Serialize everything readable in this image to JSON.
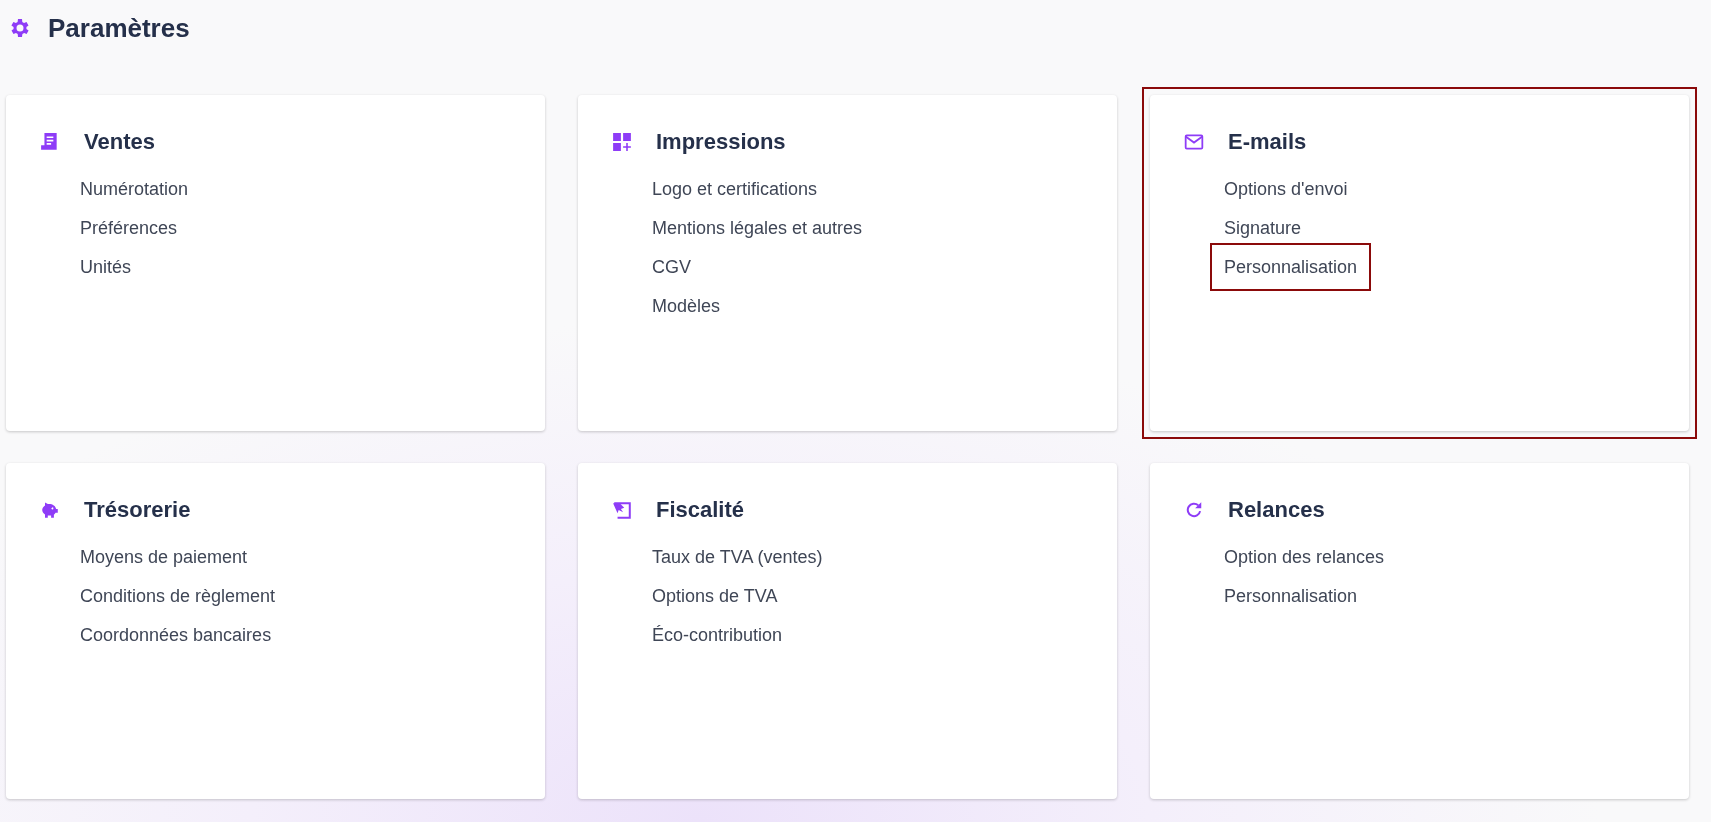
{
  "page": {
    "title": "Paramètres"
  },
  "cards": [
    {
      "title": "Ventes",
      "highlighted": false,
      "items": [
        {
          "label": "Numérotation",
          "highlighted": false
        },
        {
          "label": "Préférences",
          "highlighted": false
        },
        {
          "label": "Unités",
          "highlighted": false
        }
      ]
    },
    {
      "title": "Impressions",
      "highlighted": false,
      "items": [
        {
          "label": "Logo et certifications",
          "highlighted": false
        },
        {
          "label": "Mentions légales et autres",
          "highlighted": false
        },
        {
          "label": "CGV",
          "highlighted": false
        },
        {
          "label": "Modèles",
          "highlighted": false
        }
      ]
    },
    {
      "title": "E-mails",
      "highlighted": true,
      "items": [
        {
          "label": "Options d'envoi",
          "highlighted": false
        },
        {
          "label": "Signature",
          "highlighted": false
        },
        {
          "label": "Personnalisation",
          "highlighted": true
        }
      ]
    },
    {
      "title": "Trésorerie",
      "highlighted": false,
      "items": [
        {
          "label": "Moyens de paiement",
          "highlighted": false
        },
        {
          "label": "Conditions de règlement",
          "highlighted": false
        },
        {
          "label": "Coordonnées bancaires",
          "highlighted": false
        }
      ]
    },
    {
      "title": "Fiscalité",
      "highlighted": false,
      "items": [
        {
          "label": "Taux de TVA (ventes)",
          "highlighted": false
        },
        {
          "label": "Options de TVA",
          "highlighted": false
        },
        {
          "label": "Éco-contribution",
          "highlighted": false
        }
      ]
    },
    {
      "title": "Relances",
      "highlighted": false,
      "items": [
        {
          "label": "Option des relances",
          "highlighted": false
        },
        {
          "label": "Personnalisation",
          "highlighted": false
        }
      ]
    }
  ]
}
